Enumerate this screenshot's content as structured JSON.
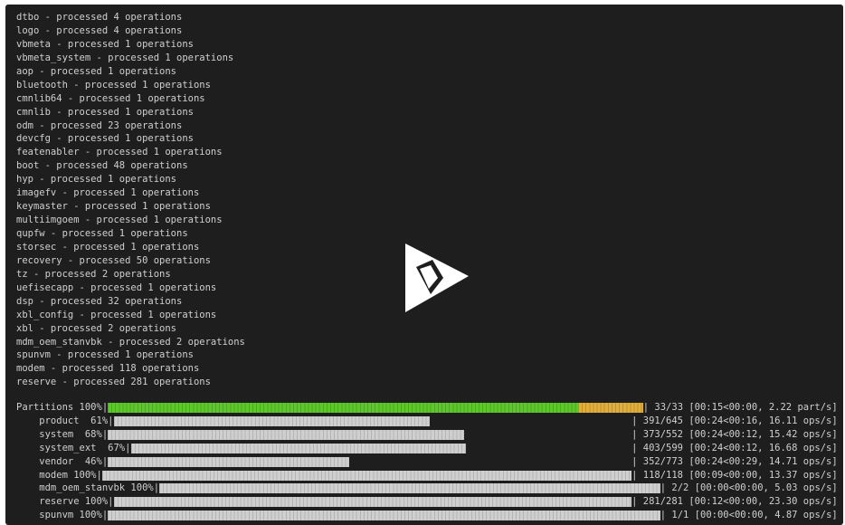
{
  "log_lines": [
    "dtbo - processed 4 operations",
    "logo - processed 4 operations",
    "vbmeta - processed 1 operations",
    "vbmeta_system - processed 1 operations",
    "aop - processed 1 operations",
    "bluetooth - processed 1 operations",
    "cmnlib64 - processed 1 operations",
    "cmnlib - processed 1 operations",
    "odm - processed 23 operations",
    "devcfg - processed 1 operations",
    "featenabler - processed 1 operations",
    "boot - processed 48 operations",
    "hyp - processed 1 operations",
    "imagefv - processed 1 operations",
    "keymaster - processed 1 operations",
    "multiimgoem - processed 1 operations",
    "qupfw - processed 1 operations",
    "storsec - processed 1 operations",
    "recovery - processed 50 operations",
    "tz - processed 2 operations",
    "uefisecapp - processed 1 operations",
    "dsp - processed 32 operations",
    "xbl_config - processed 1 operations",
    "xbl - processed 2 operations",
    "mdm_oem_stanvbk - processed 2 operations",
    "spunvm - processed 1 operations",
    "modem - processed 118 operations",
    "reserve - processed 281 operations"
  ],
  "progress": [
    {
      "label": "Partitions 100%|",
      "stats": "| 33/33 [00:15<00:00, 2.22 part/s]",
      "fraction": 1.0,
      "style": "partitions",
      "split_fraction": 0.879
    },
    {
      "label": "    product  61%|",
      "stats": "| 391/645 [00:24<00:16, 16.11 ops/s]",
      "fraction": 0.61,
      "style": "gray"
    },
    {
      "label": "    system  68%|",
      "stats": "| 373/552 [00:24<00:12, 15.42 ops/s]",
      "fraction": 0.68,
      "style": "gray"
    },
    {
      "label": "    system_ext  67%|",
      "stats": "| 403/599 [00:24<00:12, 16.68 ops/s]",
      "fraction": 0.67,
      "style": "gray"
    },
    {
      "label": "    vendor  46%|",
      "stats": "| 352/773 [00:24<00:29, 14.71 ops/s]",
      "fraction": 0.46,
      "style": "gray"
    },
    {
      "label": "    modem 100%|",
      "stats": "| 118/118 [00:09<00:00, 13.37 ops/s]",
      "fraction": 1.0,
      "style": "gray"
    },
    {
      "label": "    mdm_oem_stanvbk 100%|",
      "stats": "| 2/2 [00:00<00:00, 5.03 ops/s]",
      "fraction": 1.0,
      "style": "gray"
    },
    {
      "label": "    reserve 100%|",
      "stats": "| 281/281 [00:12<00:00, 23.30 ops/s]",
      "fraction": 1.0,
      "style": "gray"
    },
    {
      "label": "    spunvm 100%|",
      "stats": "| 1/1 [00:00<00:00, 4.87 ops/s]",
      "fraction": 1.0,
      "style": "gray"
    }
  ],
  "overlay": {
    "icon": "play-icon"
  },
  "colors": {
    "background": "#1e1e1e",
    "text": "#d0d0d0",
    "bar_gray": "#cfcfcf",
    "bar_green": "#5cc82a",
    "bar_orange": "#e2ae3a"
  }
}
